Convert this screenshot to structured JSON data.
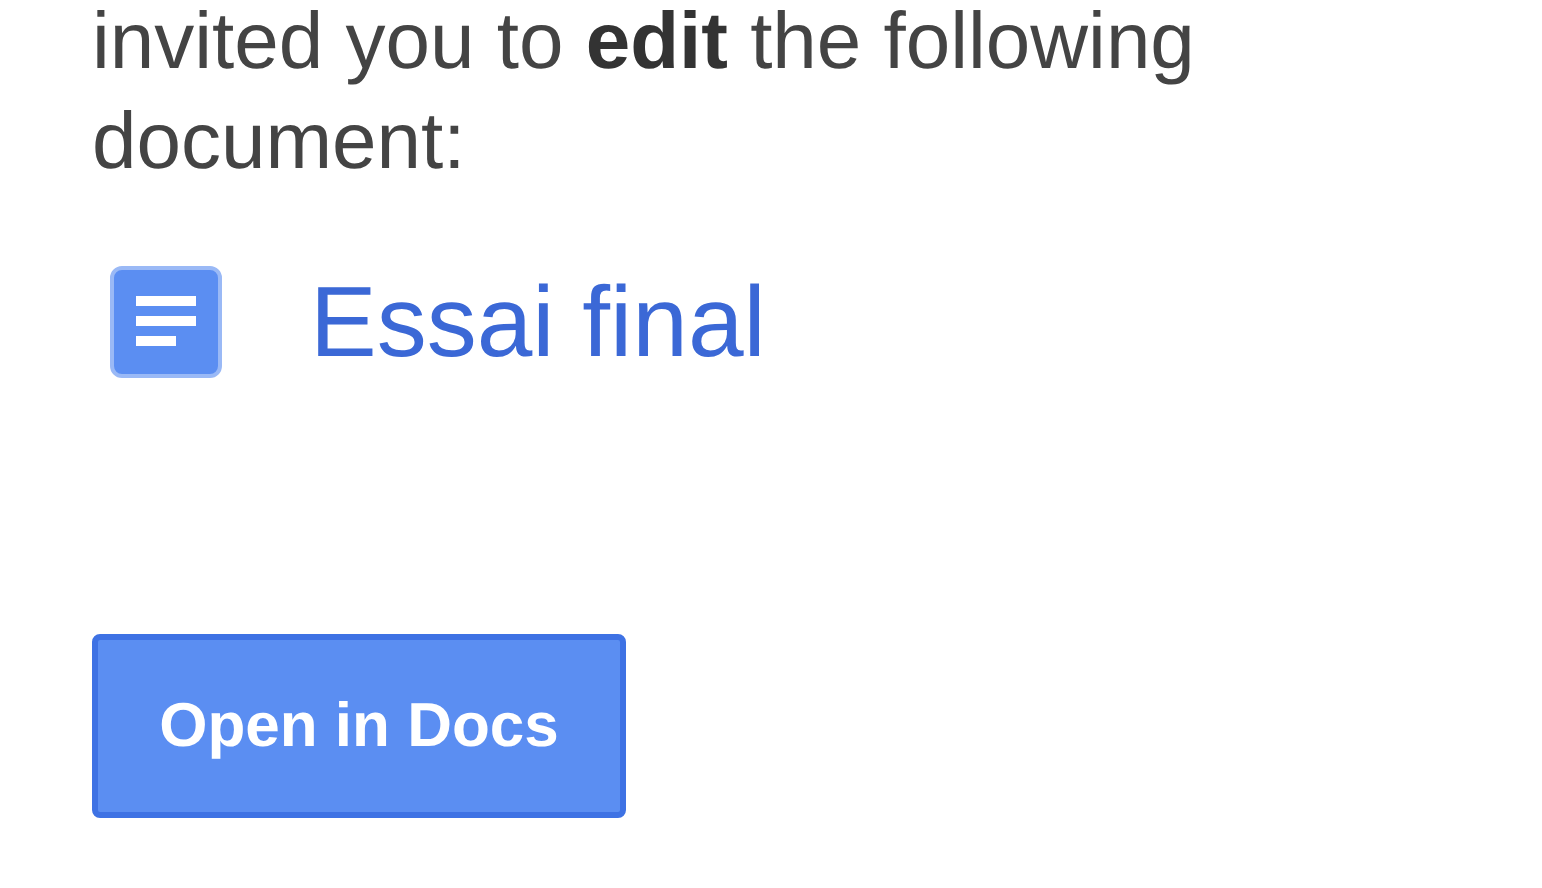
{
  "message": "invited you to **edit** the following document:",
  "document": {
    "title": "Essai final"
  },
  "button": {
    "label": "Open in Docs"
  }
}
